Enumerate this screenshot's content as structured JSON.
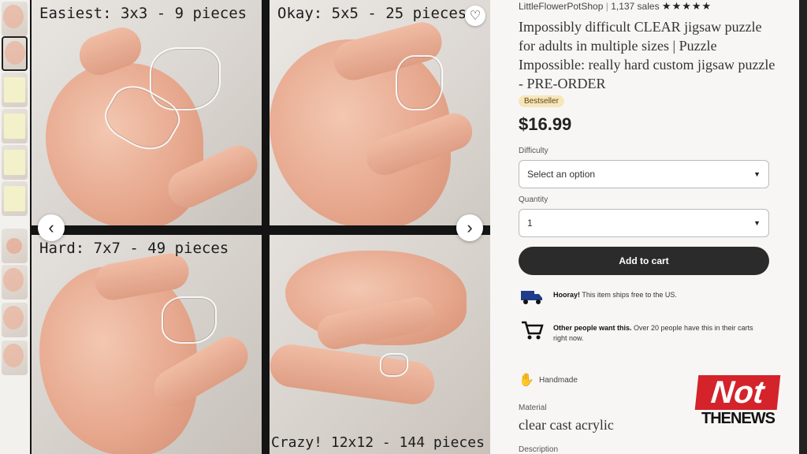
{
  "panels": [
    {
      "label": "Easiest: 3x3 - 9 pieces"
    },
    {
      "label": "Okay: 5x5 - 25 pieces"
    },
    {
      "label": "Hard: 7x7 - 49 pieces"
    },
    {
      "label": "Crazy! 12x12 - 144 pieces"
    }
  ],
  "gallery": {
    "prev_icon": "chevron-left-icon",
    "next_icon": "chevron-right-icon",
    "prev_glyph": "‹",
    "next_glyph": "›",
    "favorite_icon": "heart-icon",
    "favorite_glyph": "♡"
  },
  "listing": {
    "shop_name": "LittleFlowerPotShop",
    "sales": "1,137 sales",
    "stars": "★★★★★",
    "title": "Impossibly difficult CLEAR jigsaw puzzle for adults in multiple sizes | Puzzle Impossible: really hard custom jigsaw puzzle - PRE-ORDER",
    "badge": "Bestseller",
    "price": "$16.99",
    "difficulty_label": "Difficulty",
    "difficulty_value": "Select an option",
    "quantity_label": "Quantity",
    "quantity_value": "1",
    "add_to_cart": "Add to cart",
    "shipping_bold": "Hooray!",
    "shipping_text": " This item ships free to the US.",
    "demand_bold": "Other people want this.",
    "demand_text": " Over 20 people have this in their carts right now.",
    "handmade": "Handmade",
    "material_label": "Material",
    "material_value": "clear cast acrylic",
    "description_label": "Description"
  },
  "watermark": {
    "top": "Not",
    "bottom": "THENEWS"
  },
  "colors": {
    "cart_button": "#2b2b2b",
    "badge_bg": "#f6e6b9",
    "logo_red": "#d4232a"
  }
}
